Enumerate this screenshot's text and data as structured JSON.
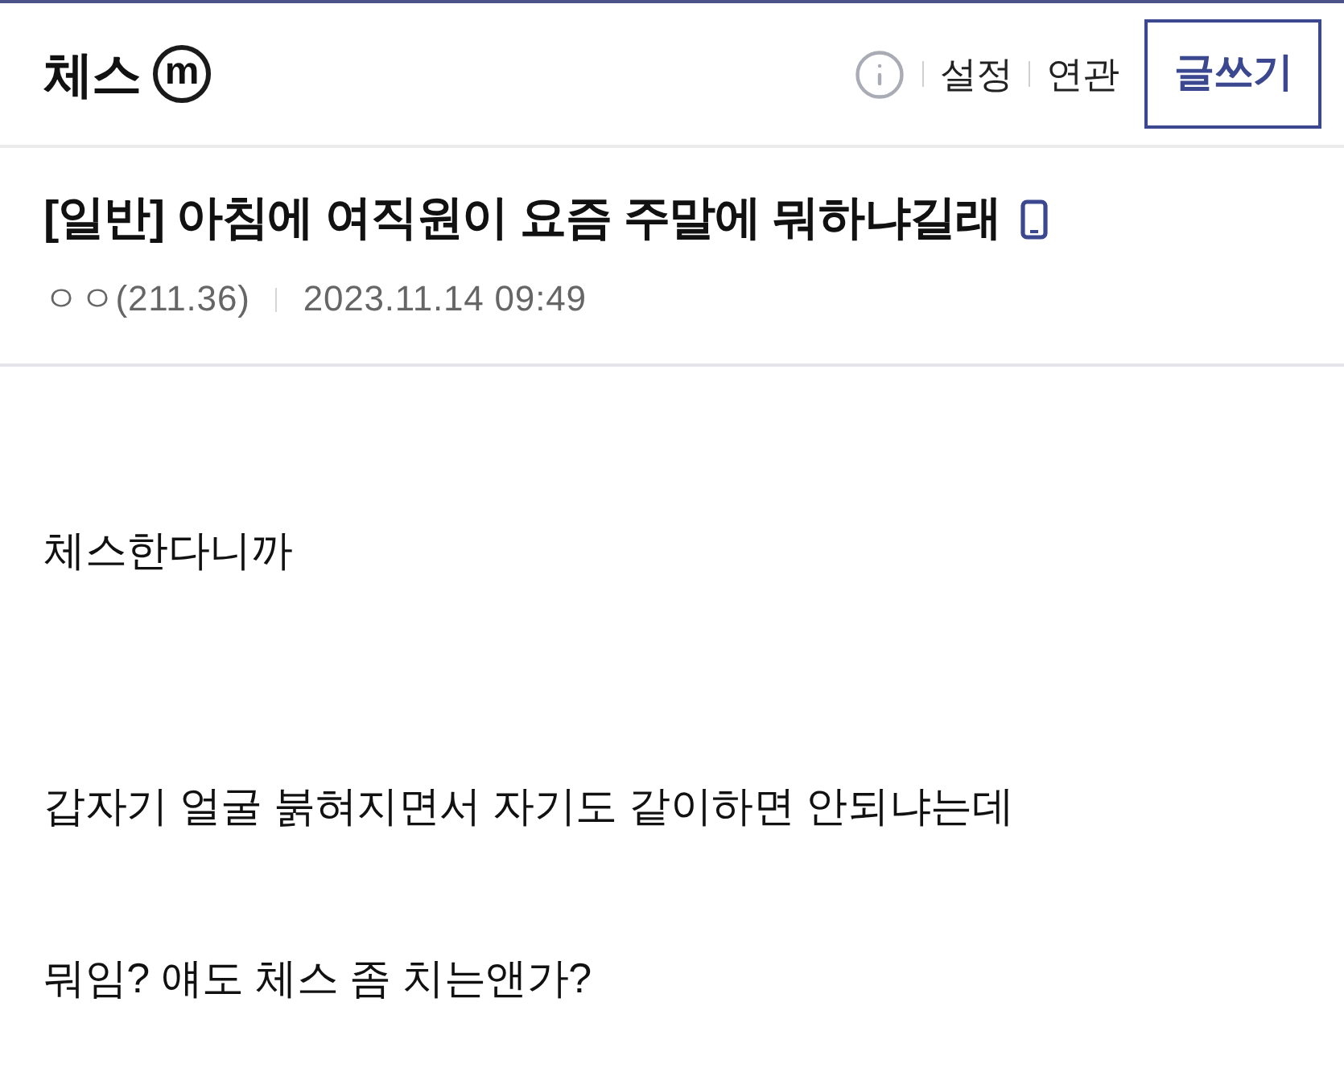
{
  "gallery": {
    "name": "체스",
    "badge": "m",
    "links": [
      "설정",
      "연관"
    ],
    "write_button": "글쓰기"
  },
  "post": {
    "title": "[일반] 아침에 여직원이 요즘 주말에 뭐하냐길래",
    "mobile": true,
    "author": "ㅇㅇ(211.36)",
    "date": "2023.11.14 09:49"
  },
  "body": {
    "paragraphs": [
      "체스한다니까",
      "갑자기 얼굴 붉혀지면서 자기도 같이하면 안되냐는데",
      "뭐임? 얘도 체스 좀 치는앤가?"
    ]
  }
}
